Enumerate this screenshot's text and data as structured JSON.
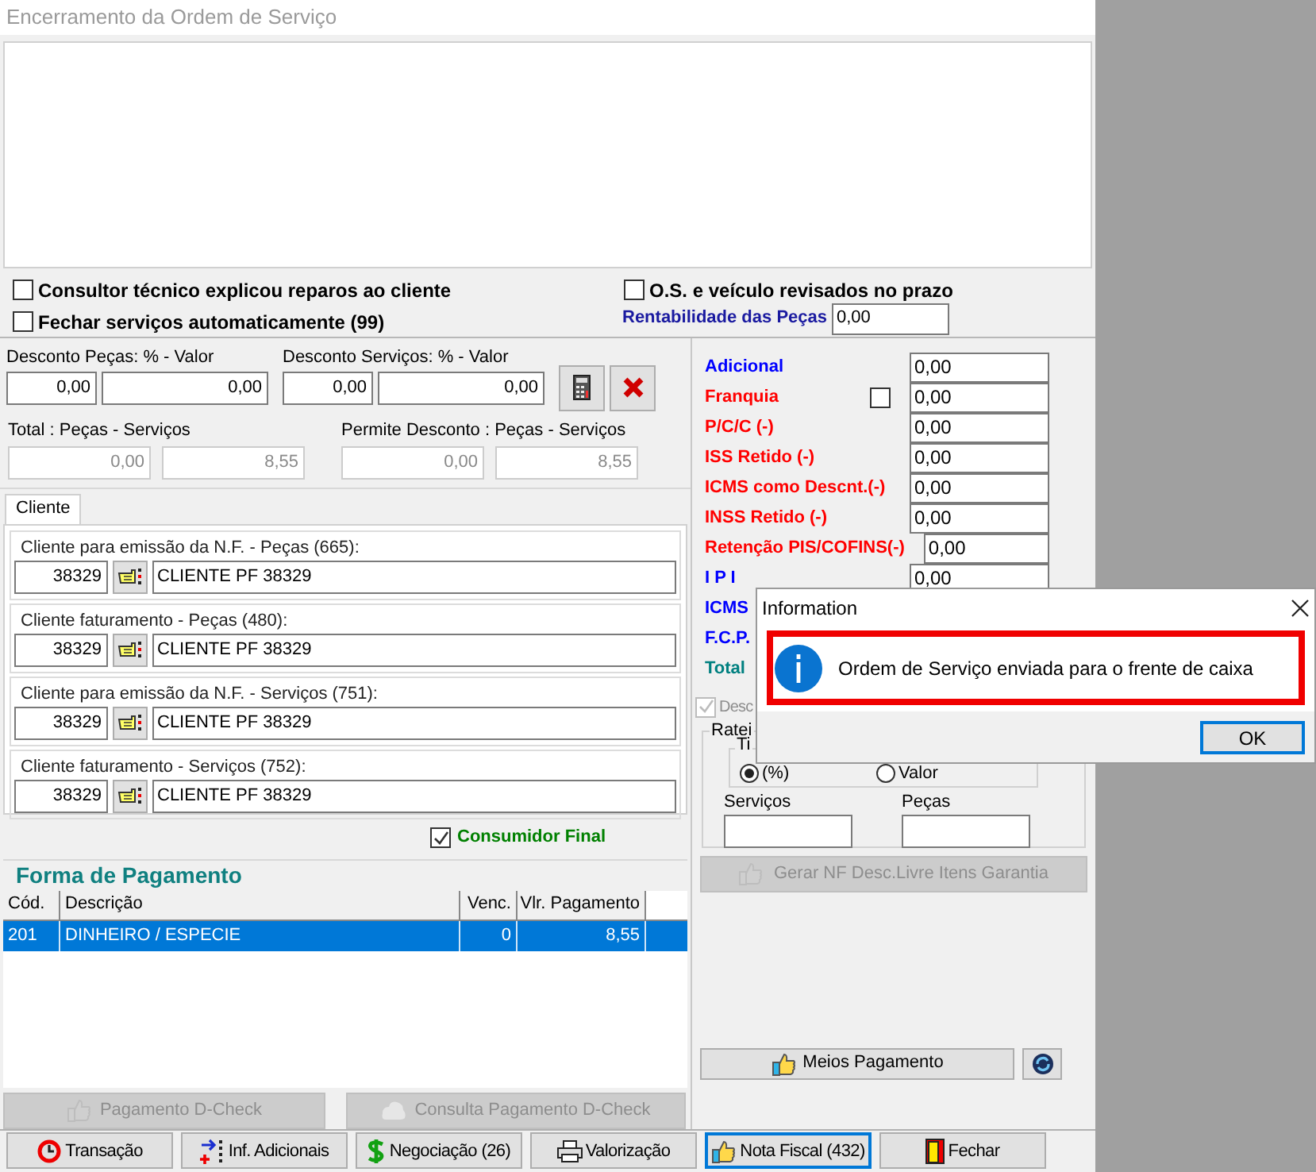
{
  "window": {
    "title": "Encerramento da Ordem de Serviço"
  },
  "options": [
    {
      "label": "Consultor técnico explicou reparos ao cliente",
      "checked": false
    },
    {
      "label": "O.S. e veículo revisados no prazo",
      "checked": false
    },
    {
      "label": "Fechar serviços automaticamente (99)",
      "checked": false
    }
  ],
  "rentabilidade": {
    "label": "Rentabilidade das Peças",
    "value": "0,00"
  },
  "discounts": [
    {
      "label": "Desconto Peças: % - Valor",
      "percent": "0,00",
      "value": "0,00"
    },
    {
      "label": "Desconto Serviços: % - Valor",
      "percent": "0,00",
      "value": "0,00"
    }
  ],
  "totals": [
    {
      "label": "Total : Peças - Serviços",
      "pecas": "0,00",
      "servicos": "8,55"
    },
    {
      "label": "Permite Desconto : Peças - Serviços",
      "pecas": "0,00",
      "servicos": "8,55"
    }
  ],
  "tabs": [
    {
      "label": "Cliente",
      "selected": true
    }
  ],
  "clients": [
    {
      "label": "Cliente para emissão da N.F. - Peças (665):",
      "code": "38329",
      "name": "CLIENTE PF 38329"
    },
    {
      "label": "Cliente faturamento - Peças (480):",
      "code": "38329",
      "name": "CLIENTE PF 38329"
    },
    {
      "label": "Cliente para emissão da N.F. - Serviços (751):",
      "code": "38329",
      "name": "CLIENTE PF 38329"
    },
    {
      "label": "Cliente faturamento - Serviços (752):",
      "code": "38329",
      "name": "CLIENTE PF 38329"
    }
  ],
  "consumidor_final": {
    "label": "Consumidor Final",
    "checked": true
  },
  "payment": {
    "title": "Forma de Pagamento",
    "columns": [
      "Cód.",
      "Descrição",
      "Venc.",
      "Vlr. Pagamento"
    ],
    "rows": [
      {
        "cells": [
          "201",
          "DINHEIRO / ESPECIE",
          "0",
          "8,55"
        ],
        "selected": true
      }
    ]
  },
  "dcheck_buttons": [
    {
      "label": "Pagamento D-Check",
      "disabled": true,
      "kind": "thumb"
    },
    {
      "label": "Consulta Pagamento D-Check",
      "disabled": true,
      "kind": "cloud"
    }
  ],
  "adjustments": [
    {
      "label": "Adicional",
      "color": "#0000ff",
      "value": "0,00",
      "kind": "field"
    },
    {
      "label": "Franquia",
      "color": "#ff0000",
      "value": "0,00",
      "kind": "checkbox",
      "checked": false
    },
    {
      "label": "P/C/C (-)",
      "color": "#ff0000",
      "value": "0,00",
      "kind": "field"
    },
    {
      "label": "ISS Retido (-)",
      "color": "#ff0000",
      "value": "0,00",
      "kind": "field"
    },
    {
      "label": "ICMS como Descnt.(-)",
      "color": "#ff0000",
      "value": "0,00",
      "kind": "field"
    },
    {
      "label": "INSS Retido (-)",
      "color": "#ff0000",
      "value": "0,00",
      "kind": "field"
    },
    {
      "label": "Retenção PIS/COFINS(-)",
      "color": "#ff0000",
      "value": "0,00",
      "kind": "field"
    },
    {
      "label": "I P I",
      "color": "#0000ff",
      "value": "0,00",
      "kind": "field"
    },
    {
      "label": "ICMS",
      "color": "#0000ff",
      "kind": "label"
    },
    {
      "label": "F.C.P.",
      "color": "#0000ff",
      "kind": "label"
    },
    {
      "label": "Total",
      "color": "#008080",
      "kind": "label"
    }
  ],
  "rateio": {
    "checkbox": {
      "label": "Desc",
      "checked": true,
      "disabled": true
    },
    "group_label": "Ratei",
    "type_label": "Ti",
    "options": [
      {
        "label": "(%)",
        "selected": true
      },
      {
        "label": "Valor",
        "selected": false
      }
    ],
    "fields": [
      {
        "label": "Serviços"
      },
      {
        "label": "Peças"
      }
    ]
  },
  "gerar_button": {
    "label": "Gerar NF Desc.Livre Itens Garantia",
    "disabled": true
  },
  "meios_button": {
    "label": "Meios Pagamento"
  },
  "toolbar": [
    {
      "label": "Transação",
      "kind": "transacao",
      "selected": false
    },
    {
      "label": "Inf. Adicionais",
      "kind": "info",
      "selected": false
    },
    {
      "label": "Negociação (26)",
      "kind": "money",
      "selected": false
    },
    {
      "label": "Valorização",
      "kind": "printer",
      "selected": false
    },
    {
      "label": "Nota Fiscal (432)",
      "kind": "thumb",
      "selected": true
    },
    {
      "label": "Fechar",
      "kind": "door",
      "selected": false
    }
  ],
  "dialog": {
    "title": "Information",
    "message": "Ordem de Serviço enviada para o frente de caixa",
    "button": "OK"
  }
}
